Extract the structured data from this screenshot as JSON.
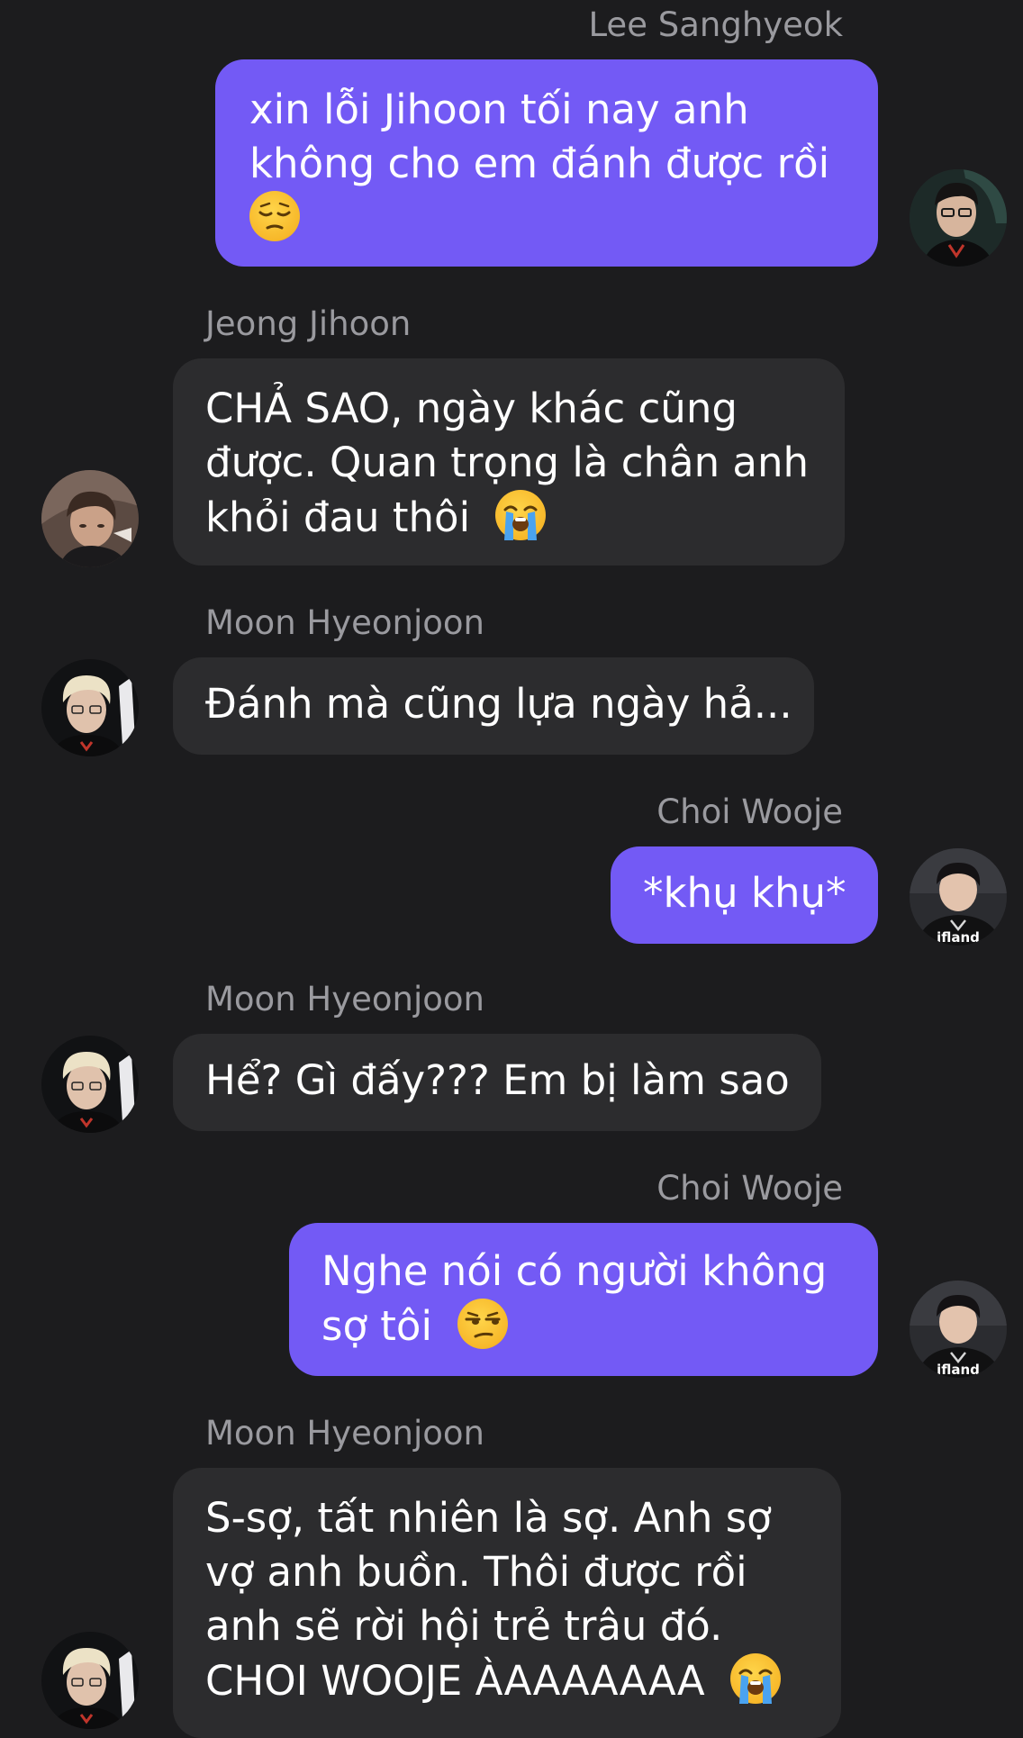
{
  "chat": {
    "messages": [
      {
        "sender": "Lee Sanghyeok",
        "direction": "outgoing",
        "lines": [
          "xin lỗi Jihoon tối nay anh",
          "không cho em đánh được rồi",
          ""
        ],
        "emoji": "pensive-face-emoji"
      },
      {
        "sender": "Jeong Jihoon",
        "direction": "incoming",
        "lines": [
          "CHẢ SAO, ngày khác cũng",
          "được. Quan trọng là chân anh",
          "khỏi đau thôi"
        ],
        "emoji": "loudly-crying-face-emoji"
      },
      {
        "sender": "Moon Hyeonjoon",
        "direction": "incoming",
        "lines": [
          "Đánh mà cũng lựa ngày hả..."
        ]
      },
      {
        "sender": "Choi Wooje",
        "direction": "outgoing",
        "lines": [
          "*khụ khụ*"
        ]
      },
      {
        "sender": "Moon Hyeonjoon",
        "direction": "incoming",
        "lines": [
          "Hể? Gì đấy??? Em bị làm sao"
        ]
      },
      {
        "sender": "Choi Wooje",
        "direction": "outgoing",
        "lines": [
          "Nghe nói có người không",
          "sợ tôi"
        ],
        "emoji": "unamused-face-emoji"
      },
      {
        "sender": "Moon Hyeonjoon",
        "direction": "incoming",
        "lines": [
          "S-sợ, tất nhiên là sợ. Anh sợ",
          "vợ anh buồn. Thôi được rồi",
          "anh sẽ rời hội trẻ trâu đó.",
          "CHOI WOOJE ÀAAAAAAA"
        ],
        "emoji": "loudly-crying-face-emoji"
      }
    ],
    "avatar_jersey_text": "ifland"
  },
  "colors": {
    "background": "#1c1c1e",
    "outgoing_bubble": "#735af5",
    "incoming_bubble": "#2c2c2e",
    "sender_name": "#9a9a9f",
    "message_text": "#ffffff"
  }
}
